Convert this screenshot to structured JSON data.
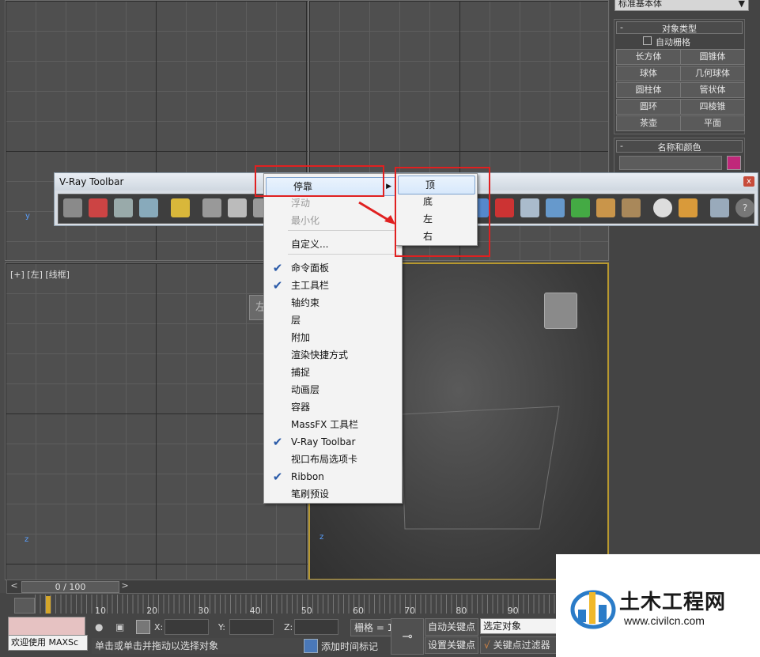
{
  "viewport_labels": {
    "left": "[+] [左] [线框]"
  },
  "view_cube_label": "左",
  "command_panel": {
    "dropdown": "标准基本体",
    "object_type": {
      "title": "对象类型",
      "auto_grid": "自动栅格",
      "buttons": [
        "长方体",
        "圆锥体",
        "球体",
        "几何球体",
        "圆柱体",
        "管状体",
        "圆环",
        "四棱锥",
        "茶壶",
        "平面"
      ]
    },
    "name_color": {
      "title": "名称和颜色"
    },
    "swatch_color": "#c0287a"
  },
  "vray_toolbar": {
    "title": "V-Ray Toolbar",
    "close": "x"
  },
  "context_menu": {
    "items": [
      {
        "label": "停靠",
        "checked": false,
        "disabled": false,
        "submenu": true
      },
      {
        "label": "浮动",
        "checked": false,
        "disabled": true
      },
      {
        "label": "最小化",
        "checked": false,
        "disabled": true
      },
      {
        "label": "自定义...",
        "checked": false,
        "disabled": false
      },
      {
        "label": "命令面板",
        "checked": true,
        "disabled": false
      },
      {
        "label": "主工具栏",
        "checked": true,
        "disabled": false
      },
      {
        "label": "轴约束",
        "checked": false,
        "disabled": false
      },
      {
        "label": "层",
        "checked": false,
        "disabled": false
      },
      {
        "label": "附加",
        "checked": false,
        "disabled": false
      },
      {
        "label": "渲染快捷方式",
        "checked": false,
        "disabled": false
      },
      {
        "label": "捕捉",
        "checked": false,
        "disabled": false
      },
      {
        "label": "动画层",
        "checked": false,
        "disabled": false
      },
      {
        "label": "容器",
        "checked": false,
        "disabled": false
      },
      {
        "label": "MassFX 工具栏",
        "checked": false,
        "disabled": false
      },
      {
        "label": "V-Ray Toolbar",
        "checked": true,
        "disabled": false
      },
      {
        "label": "视口布局选项卡",
        "checked": false,
        "disabled": false
      },
      {
        "label": "Ribbon",
        "checked": true,
        "disabled": false
      },
      {
        "label": "笔刷预设",
        "checked": false,
        "disabled": false
      }
    ]
  },
  "dock_submenu": {
    "items": [
      "顶",
      "底",
      "左",
      "右"
    ]
  },
  "timeline": {
    "frame_counter": "0 / 100",
    "prev": "<",
    "next": ">",
    "ticks": [
      "10",
      "20",
      "30",
      "40",
      "50",
      "60",
      "70",
      "80",
      "90"
    ]
  },
  "status": {
    "maxscript": "欢迎使用 MAXSc",
    "prompt": "单击或单击并拖动以选择对象",
    "x_label": "X:",
    "y_label": "Y:",
    "z_label": "Z:",
    "grid": "栅格 = 1",
    "add_time_tag": "添加时间标记",
    "auto_key": "自动关键点",
    "set_key": "设置关键点",
    "selection": "选定对象",
    "key_filter": "关键点过滤器"
  },
  "watermark": {
    "cn": "土木工程网",
    "url": "www.civilcn.com"
  }
}
